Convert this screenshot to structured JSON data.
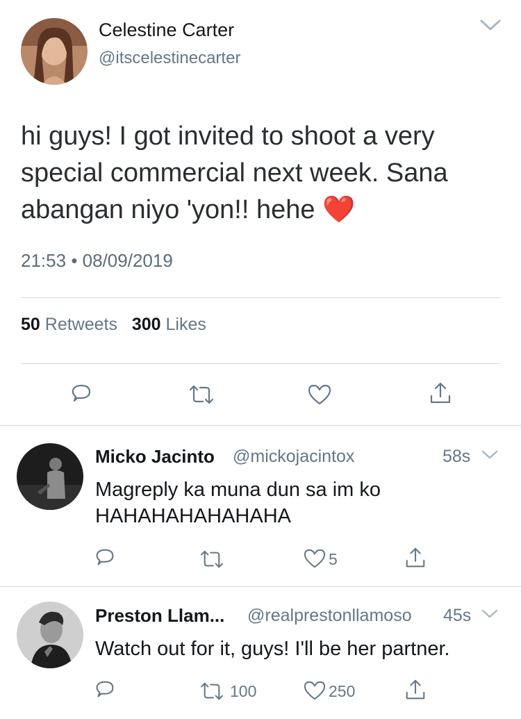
{
  "main_tweet": {
    "author_name": "Celestine Carter",
    "author_handle": "@itscelestinecarter",
    "text": "hi guys! I got invited to shoot a very special commercial next week. Sana abangan niyo 'yon!! hehe ❤️",
    "time": "21:53",
    "separator": "•",
    "date": "08/09/2019",
    "retweet_count": "50",
    "retweet_label": "Retweets",
    "like_count": "300",
    "like_label": "Likes"
  },
  "replies": [
    {
      "author_name": "Micko Jacinto",
      "author_handle": "@mickojacintox",
      "time": "58s",
      "text": "Magreply ka muna dun sa im ko HAHAHAHAHAHAHA",
      "retweet_count": "",
      "like_count": "5"
    },
    {
      "author_name": "Preston Llam...",
      "author_handle": "@realprestonllamoso",
      "time": "45s",
      "text": "Watch out for it, guys! I'll be her partner.",
      "retweet_count": "100",
      "like_count": "250"
    }
  ],
  "icons": {
    "reply": "reply-icon",
    "retweet": "retweet-icon",
    "like": "heart-icon",
    "share": "share-icon",
    "more": "chevron-down-icon"
  },
  "colors": {
    "text": "#14171a",
    "muted": "#657786",
    "divider": "#d6dadd",
    "heart_emoji": "#e0245e"
  }
}
